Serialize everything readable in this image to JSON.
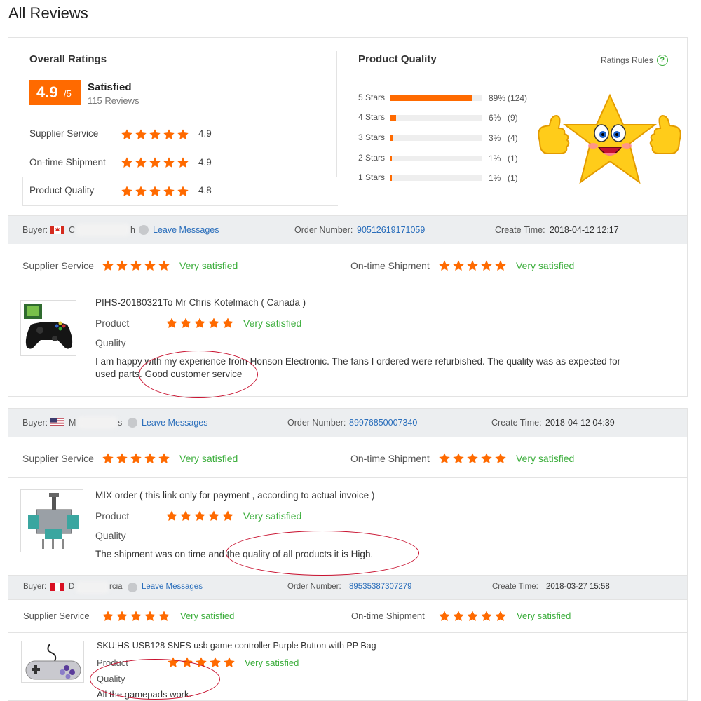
{
  "page_title": "All Reviews",
  "colors": {
    "accent": "#ff6a00",
    "positive": "#3cae3c",
    "link": "#2a6ebb"
  },
  "overall": {
    "title": "Overall Ratings",
    "score": "4.9",
    "score_max": "/5",
    "label": "Satisfied",
    "review_count": "115 Reviews",
    "rows": [
      {
        "label": "Supplier Service",
        "value": "4.9",
        "stars": 5
      },
      {
        "label": "On-time Shipment",
        "value": "4.9",
        "stars": 5
      },
      {
        "label": "Product Quality",
        "value": "4.8",
        "stars": 5
      }
    ]
  },
  "quality": {
    "title": "Product Quality",
    "rules_label": "Ratings Rules",
    "help_glyph": "?",
    "bars": [
      {
        "label": "5 Stars",
        "pct_text": "89%",
        "count": "(124)",
        "fraction": 0.89
      },
      {
        "label": "4 Stars",
        "pct_text": "6%",
        "count": "(9)",
        "fraction": 0.06
      },
      {
        "label": "3 Stars",
        "pct_text": "3%",
        "count": "(4)",
        "fraction": 0.03
      },
      {
        "label": "2 Stars",
        "pct_text": "1%",
        "count": "(1)",
        "fraction": 0.01
      },
      {
        "label": "1 Stars",
        "pct_text": "1%",
        "count": "(1)",
        "fraction": 0.01
      }
    ],
    "mascot_icon": "smiling-star-thumbs-up"
  },
  "labels": {
    "buyer": "Buyer:",
    "leave_messages": "Leave Messages",
    "order_number": "Order Number:",
    "create_time": "Create Time:",
    "supplier_service": "Supplier Service",
    "ontime_shipment": "On-time Shipment",
    "very_satisfied": "Very satisfied",
    "product": "Product",
    "quality": "Quality"
  },
  "reviews": [
    {
      "buyer_initial": "C",
      "buyer_tail": "h",
      "flag": "canada",
      "order_number": "90512619171059",
      "create_time": "2018-04-12 12:17",
      "product_title": "PIHS-20180321To Mr Chris Kotelmach ( Canada )",
      "comment_line1": "I am happy with my experience from Honson Electronic. The fans I ordered were refurbished. The quality was as expected for",
      "comment_line2": "used parts. Good customer service",
      "thumb_icon": "xbox-controller"
    },
    {
      "buyer_initial": "M",
      "buyer_tail": "s",
      "flag": "usa",
      "order_number": "89976850007340",
      "create_time": "2018-04-12 04:39",
      "product_title": "MIX order ( this link only for payment , according to actual invoice )",
      "comment_line1": "The shipment was on time and the quality of all products it is High.",
      "comment_line2": "",
      "thumb_icon": "analog-joystick-module"
    },
    {
      "buyer_initial": "D",
      "buyer_tail": "rcia",
      "flag": "peru",
      "order_number": "89535387307279",
      "create_time": "2018-03-27 15:58",
      "product_title": "SKU:HS-USB128 SNES usb game controller Purple Button with PP Bag",
      "comment_line1": "All the gamepads work.",
      "comment_line2": "",
      "thumb_icon": "snes-controller"
    }
  ]
}
